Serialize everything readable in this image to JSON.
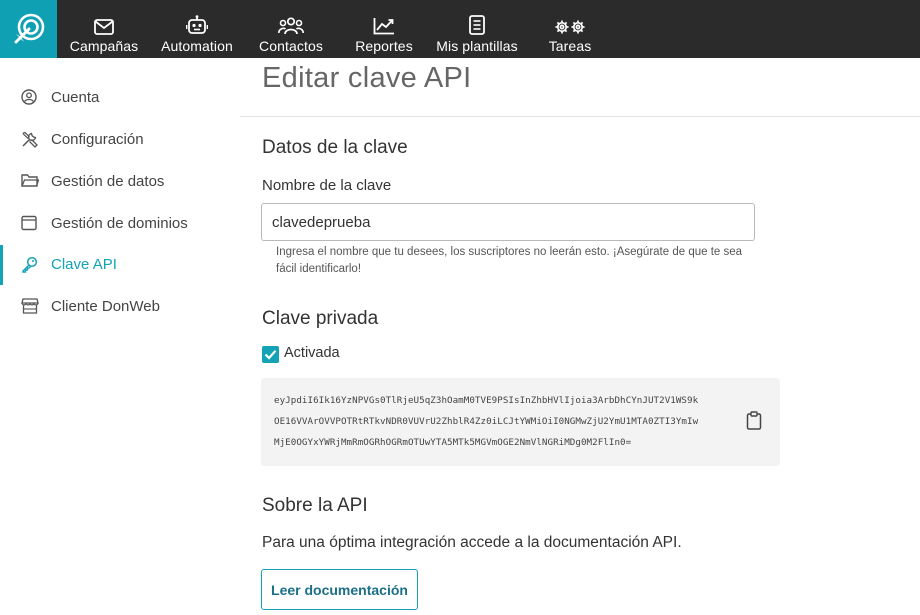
{
  "topnav": {
    "items": [
      {
        "label": "Campañas",
        "icon": "envelope-icon"
      },
      {
        "label": "Automation",
        "icon": "robot-icon"
      },
      {
        "label": "Contactos",
        "icon": "users-icon"
      },
      {
        "label": "Reportes",
        "icon": "chart-icon"
      },
      {
        "label": "Mis plantillas",
        "icon": "document-icon"
      },
      {
        "label": "Tareas",
        "icon": "gears-icon"
      }
    ]
  },
  "sidebar": {
    "items": [
      {
        "label": "Cuenta",
        "icon": "user-circle-icon"
      },
      {
        "label": "Configuración",
        "icon": "tools-icon"
      },
      {
        "label": "Gestión de datos",
        "icon": "folder-icon"
      },
      {
        "label": "Gestión de dominios",
        "icon": "browser-window-icon"
      },
      {
        "label": "Clave API",
        "icon": "key-icon",
        "active": true
      },
      {
        "label": "Cliente DonWeb",
        "icon": "store-icon"
      }
    ]
  },
  "page": {
    "title": "Editar clave API"
  },
  "key_data": {
    "heading": "Datos de la clave",
    "name_label": "Nombre de la clave",
    "name_value": "clavedeprueba",
    "help_text": "Ingresa el nombre que tu desees, los suscriptores no leerán esto. ¡Asegúrate de que te sea fácil identificarlo!"
  },
  "private_key": {
    "heading": "Clave privada",
    "checkbox_label": "Activada",
    "checked": true,
    "key_lines": [
      "eyJpdiI6Ik16YzNPVGs0TlRjeU5qZ3hOamM0TVE9PSIsInZhbHVlIjoia3ArbDhCYnJUT2V1WS9k",
      "OE16VVArOVVPOTRtRTkvNDR0VUVrU2ZhblR4Zz0iLCJtYWMiOiI0NGMwZjU2YmU1MTA0ZTI3YmIw",
      "MjE0OGYxYWRjMmRmOGRhOGRmOTUwYTA5MTk5MGVmOGE2NmVlNGRiMDg0M2FlIn0="
    ]
  },
  "about": {
    "heading": "Sobre la API",
    "text": "Para una óptima integración accede a la documentación API.",
    "button_label": "Leer documentación"
  },
  "colors": {
    "accent": "#13a2b6",
    "topbar": "#2b2b2b"
  }
}
